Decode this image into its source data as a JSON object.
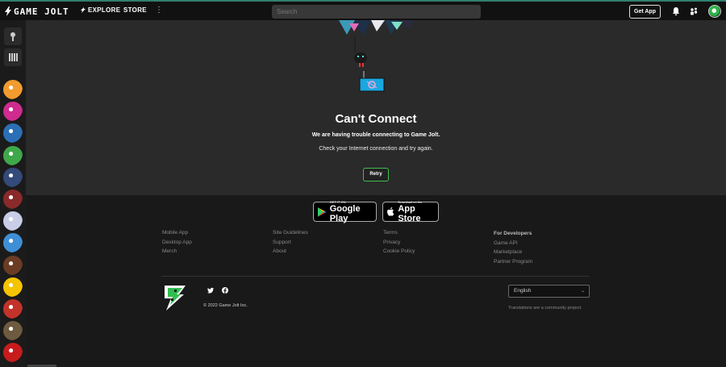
{
  "header": {
    "logo_text": "GAME JOLT",
    "explore_label": "EXPLORE",
    "store_label": "STORE",
    "more_icon": "more-vertical-icon",
    "search_placeholder": "Search",
    "get_app_label": "Get App",
    "icons": [
      "bell-icon",
      "friends-icon",
      "user-avatar"
    ],
    "accent": "#2f7f6f"
  },
  "sidebar": {
    "top_buttons": [
      "activity-icon",
      "library-icon"
    ],
    "games": [
      {
        "name": "game-1",
        "color": "#f29b2e"
      },
      {
        "name": "game-2",
        "color": "#d02b8f"
      },
      {
        "name": "game-3",
        "color": "#2c6fb5"
      },
      {
        "name": "game-4",
        "color": "#3fa84a"
      },
      {
        "name": "game-5",
        "color": "#334a7a"
      },
      {
        "name": "game-6",
        "color": "#8a2a2a"
      },
      {
        "name": "game-7",
        "color": "#c9cde8"
      },
      {
        "name": "game-8",
        "color": "#3f8fd6"
      },
      {
        "name": "game-9",
        "color": "#6b3c24"
      },
      {
        "name": "game-10",
        "color": "#f5c400"
      },
      {
        "name": "game-11",
        "color": "#c2332a"
      },
      {
        "name": "game-12",
        "color": "#6e5a3f"
      },
      {
        "name": "game-13",
        "color": "#c81c1c"
      }
    ]
  },
  "error": {
    "title": "Can't Connect",
    "line1": "We are having trouble connecting to Game Jolt.",
    "line2": "Check your Internet connection and try again.",
    "retry_label": "Retry",
    "retry_color": "#3fbf4f"
  },
  "footer": {
    "google_play": {
      "small": "GET IT ON",
      "big": "Google Play"
    },
    "app_store": {
      "small": "Download on the",
      "big": "App Store"
    },
    "col1": [
      "Mobile App",
      "Desktop App",
      "Merch"
    ],
    "col2": [
      "Site Guidelines",
      "Support",
      "About"
    ],
    "col3": [
      "Terms",
      "Privacy",
      "Cookie Policy"
    ],
    "col4_heading": "For Developers",
    "col4": [
      "Game API",
      "Marketplace",
      "Partner Program"
    ],
    "copyright": "© 2022 Game Jolt Inc.",
    "language": "English",
    "translations_note": "Translations are a community project.",
    "social_icons": [
      "twitter-icon",
      "facebook-icon"
    ]
  }
}
